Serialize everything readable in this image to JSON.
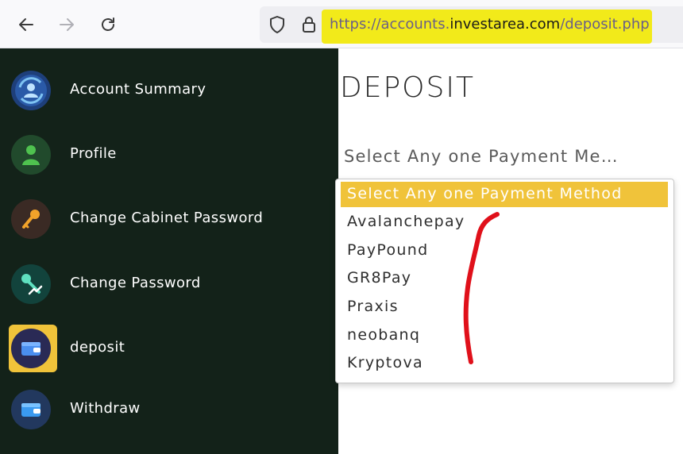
{
  "browser": {
    "url_prefix": "https://accounts.",
    "url_domain": "investarea.com",
    "url_path": "/deposit.php"
  },
  "sidebar": {
    "items": [
      {
        "label": "Account Summary",
        "icon": "account-summary-icon"
      },
      {
        "label": "Profile",
        "icon": "profile-icon"
      },
      {
        "label": "Change Cabinet Password",
        "icon": "key-icon"
      },
      {
        "label": "Change Password",
        "icon": "key-chart-icon"
      },
      {
        "label": "deposit",
        "icon": "wallet-icon",
        "active": true
      },
      {
        "label": "Withdraw",
        "icon": "withdraw-wallet-icon"
      }
    ]
  },
  "main": {
    "title": "DEPOSIT",
    "select_display": "Select Any one Payment Me…",
    "options": [
      "Select Any one Payment Method",
      "Avalanchepay",
      "PayPound",
      "GR8Pay",
      "Praxis",
      "neobanq",
      "Kryptova"
    ]
  },
  "colors": {
    "sidebar_bg": "#132219",
    "accent": "#f0c33a",
    "url_highlight": "#f2ea1a",
    "annotation": "#e0101a"
  }
}
